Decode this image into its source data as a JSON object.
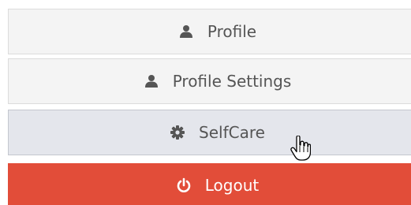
{
  "menu": {
    "items": [
      {
        "label": "Profile",
        "icon": "user-icon"
      },
      {
        "label": "Profile Settings",
        "icon": "user-icon"
      },
      {
        "label": "SelfCare",
        "icon": "gear-icon",
        "state": "hovered"
      },
      {
        "label": "Logout",
        "icon": "power-icon"
      }
    ]
  },
  "colors": {
    "logout_bg": "#e24d39",
    "hover_bg": "#e4e6ec",
    "default_bg": "#f4f4f4",
    "text": "#555555"
  },
  "cursor": {
    "type": "hand-pointer-icon"
  }
}
